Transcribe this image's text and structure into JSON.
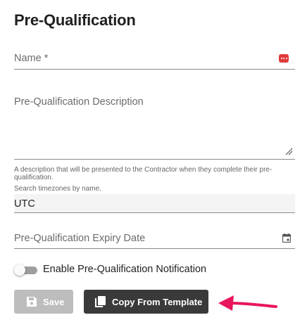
{
  "form": {
    "title": "Pre-Qualification",
    "name_label": "Name *",
    "description_label": "Pre-Qualification Description",
    "description_helper": "A description that will be presented to the Contractor when they complete their pre-qualification.",
    "timezone_helper": "Search timezones by name.",
    "timezone_value": "UTC",
    "expiry_label": "Pre-Qualification Expiry Date",
    "notification_label": "Enable Pre-Qualification Notification",
    "notification_enabled": false
  },
  "actions": {
    "save_label": "Save",
    "copy_label": "Copy From Template"
  },
  "colors": {
    "accent_arrow": "#e8175d",
    "name_icon": "#e03b3b",
    "copy_button": "#3a3a3a",
    "save_button_disabled": "#bdbdbd"
  },
  "icons": [
    "more-horizontal-icon",
    "resize-handle-icon",
    "calendar-icon",
    "save-icon",
    "copy-icon",
    "arrow-icon"
  ]
}
